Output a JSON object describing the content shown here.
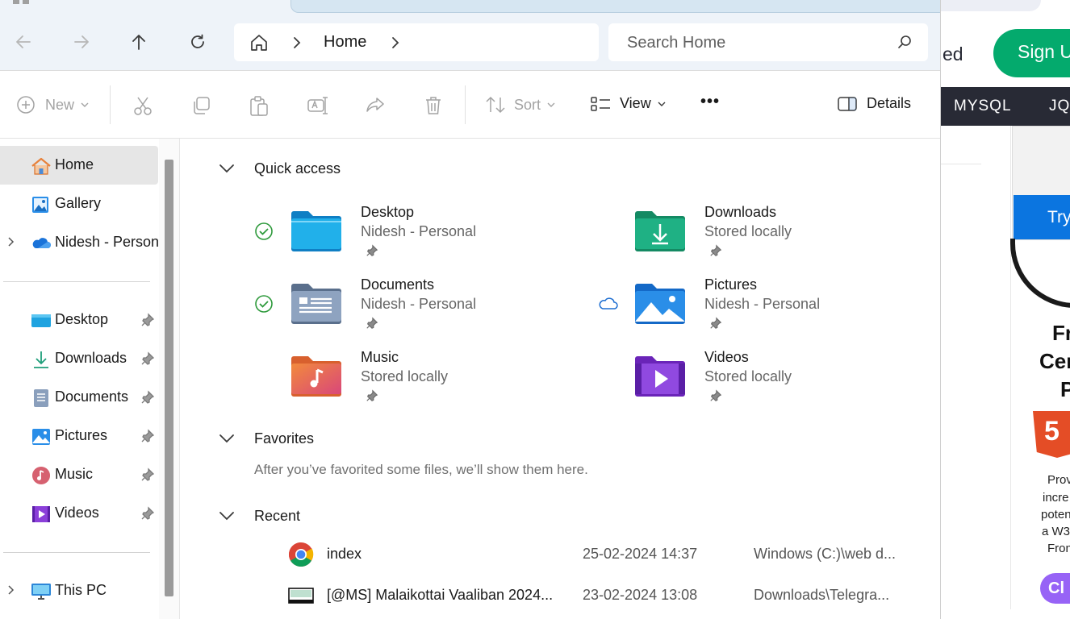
{
  "browser_bg": {
    "partial_text": "ed",
    "signup_label": "Sign U",
    "nav_items": [
      "MYSQL",
      "JQ"
    ],
    "try_label": "Try",
    "promo_lines": [
      "Fr",
      "Cer",
      "P"
    ],
    "html5_label": "5",
    "small_lines": [
      "Prov",
      "incre",
      "poten",
      "a W3",
      "Fron"
    ],
    "purple_label": "Cl"
  },
  "address": {
    "crumb": "Home",
    "search_placeholder": "Search Home"
  },
  "toolbar": {
    "new_label": "New",
    "sort_label": "Sort",
    "view_label": "View",
    "more_label": "•••",
    "details_label": "Details"
  },
  "sidebar": {
    "top_items": [
      {
        "label": "Home",
        "icon": "home-icon"
      },
      {
        "label": "Gallery",
        "icon": "gallery-icon"
      },
      {
        "label": "Nidesh - Personal",
        "icon": "onedrive-cloud-icon"
      }
    ],
    "pinned_items": [
      {
        "label": "Desktop",
        "icon": "desktop-folder-icon"
      },
      {
        "label": "Downloads",
        "icon": "downloads-icon"
      },
      {
        "label": "Documents",
        "icon": "documents-icon"
      },
      {
        "label": "Pictures",
        "icon": "pictures-icon"
      },
      {
        "label": "Music",
        "icon": "music-icon"
      },
      {
        "label": "Videos",
        "icon": "videos-icon"
      }
    ],
    "bottom_items": [
      {
        "label": "This PC",
        "icon": "this-pc-icon"
      }
    ]
  },
  "sections": {
    "quick_access": "Quick access",
    "favorites": "Favorites",
    "favorites_empty": "After you’ve favorited some files, we’ll show them here.",
    "recent": "Recent"
  },
  "quick_access": [
    {
      "name": "Desktop",
      "sub": "Nidesh - Personal",
      "status": "synced-check-icon"
    },
    {
      "name": "Downloads",
      "sub": "Stored locally",
      "status": ""
    },
    {
      "name": "Documents",
      "sub": "Nidesh - Personal",
      "status": "synced-check-icon"
    },
    {
      "name": "Pictures",
      "sub": "Nidesh - Personal",
      "status": "cloud-icon"
    },
    {
      "name": "Music",
      "sub": "Stored locally",
      "status": ""
    },
    {
      "name": "Videos",
      "sub": "Stored locally",
      "status": ""
    }
  ],
  "recent": [
    {
      "name": "index",
      "date": "25-02-2024 14:37",
      "location": "Windows (C:)\\web d...",
      "icon": "chrome-icon"
    },
    {
      "name": "[@MS] Malaikottai Vaaliban 2024...",
      "date": "23-02-2024 13:08",
      "location": "Downloads\\Telegra...",
      "icon": "video-thumbnail-icon"
    }
  ],
  "colors": {
    "accent_blue": "#0067c0",
    "sync_green": "#2e9a3c",
    "signup_green": "#04aa6d",
    "nav_dark": "#282a35"
  }
}
